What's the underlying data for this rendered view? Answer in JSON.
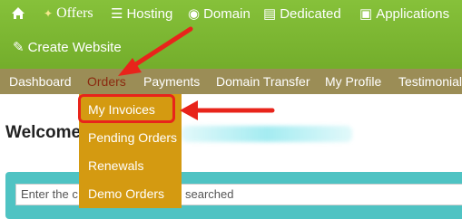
{
  "top_nav": {
    "home_icon": "home-icon",
    "offers": "Offers",
    "hosting": "Hosting",
    "domain": "Domain",
    "dedicated": "Dedicated",
    "applications": "Applications",
    "create_website": "Create Website"
  },
  "sub_nav": {
    "dashboard": "Dashboard",
    "orders": "Orders",
    "payments": "Payments",
    "domain_transfer": "Domain Transfer",
    "my_profile": "My Profile",
    "testimonials": "Testimonials"
  },
  "orders_menu": {
    "items": [
      "My Invoices",
      "Pending Orders",
      "Renewals",
      "Demo Orders"
    ]
  },
  "welcome": {
    "text": "Welcome"
  },
  "search": {
    "placeholder_left": "Enter the c",
    "placeholder_right": "searched"
  },
  "colors": {
    "top_nav_green": "#7cb82f",
    "sub_nav_olive": "#9b8d56",
    "dropdown_gold": "#d49a11",
    "accent_red": "#e8241b",
    "search_band_teal": "#4fc3c3"
  }
}
